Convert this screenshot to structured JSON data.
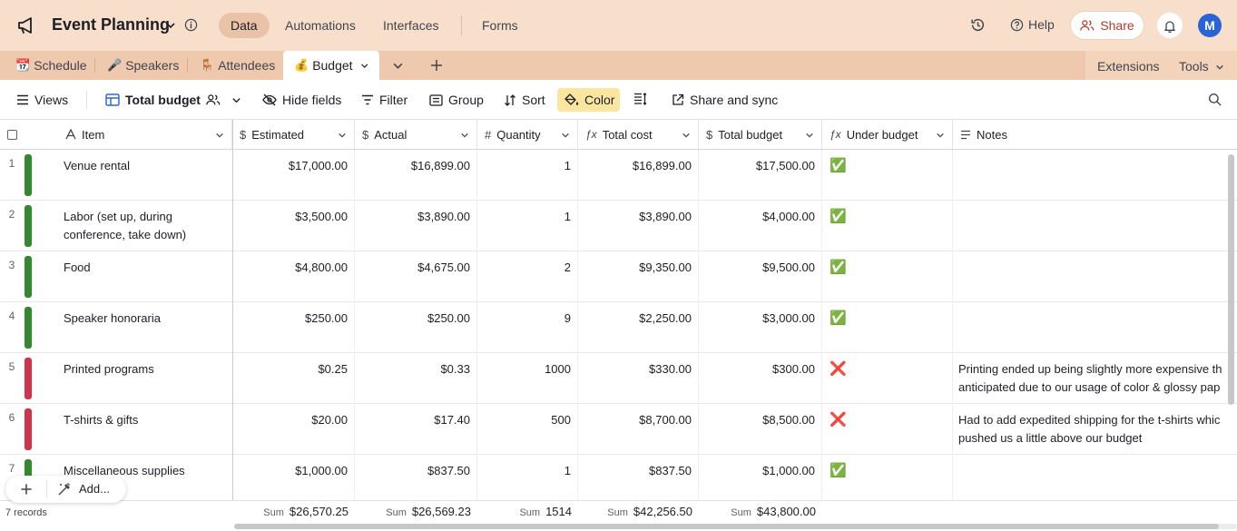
{
  "header": {
    "base_title": "Event Planning",
    "nav": [
      "Data",
      "Automations",
      "Interfaces",
      "Forms"
    ],
    "help_label": "Help",
    "share_label": "Share",
    "avatar_initial": "M"
  },
  "tables": [
    {
      "emoji": "📆",
      "label": "Schedule"
    },
    {
      "emoji": "🎤",
      "label": "Speakers"
    },
    {
      "emoji": "🪑",
      "label": "Attendees"
    },
    {
      "emoji": "💰",
      "label": "Budget"
    }
  ],
  "tabbar_right": {
    "extensions": "Extensions",
    "tools": "Tools"
  },
  "viewbar": {
    "views": "Views",
    "view_name": "Total budget",
    "hide_fields": "Hide fields",
    "filter": "Filter",
    "group": "Group",
    "sort": "Sort",
    "color": "Color",
    "share_sync": "Share and sync"
  },
  "columns": [
    "Item",
    "Estimated",
    "Actual",
    "Quantity",
    "Total cost",
    "Total budget",
    "Under budget",
    "Notes"
  ],
  "rows": [
    {
      "n": "1",
      "color": "#338a2e",
      "item": [
        "Venue rental"
      ],
      "estimated": "$17,000.00",
      "actual": "$16,899.00",
      "quantity": "1",
      "total_cost": "$16,899.00",
      "total_budget": "$17,500.00",
      "under": "✅",
      "notes": []
    },
    {
      "n": "2",
      "color": "#338a2e",
      "item": [
        "Labor (set up, during",
        "conference, take down)"
      ],
      "estimated": "$3,500.00",
      "actual": "$3,890.00",
      "quantity": "1",
      "total_cost": "$3,890.00",
      "total_budget": "$4,000.00",
      "under": "✅",
      "notes": []
    },
    {
      "n": "3",
      "color": "#338a2e",
      "item": [
        "Food"
      ],
      "estimated": "$4,800.00",
      "actual": "$4,675.00",
      "quantity": "2",
      "total_cost": "$9,350.00",
      "total_budget": "$9,500.00",
      "under": "✅",
      "notes": []
    },
    {
      "n": "4",
      "color": "#338a2e",
      "item": [
        "Speaker honoraria"
      ],
      "estimated": "$250.00",
      "actual": "$250.00",
      "quantity": "9",
      "total_cost": "$2,250.00",
      "total_budget": "$3,000.00",
      "under": "✅",
      "notes": []
    },
    {
      "n": "5",
      "color": "#d0344a",
      "item": [
        "Printed programs"
      ],
      "estimated": "$0.25",
      "actual": "$0.33",
      "quantity": "1000",
      "total_cost": "$330.00",
      "total_budget": "$300.00",
      "under": "❌",
      "notes": [
        "Printing ended up being slightly more expensive th",
        "anticipated due to our usage of color & glossy pap"
      ]
    },
    {
      "n": "6",
      "color": "#d0344a",
      "item": [
        "T-shirts & gifts"
      ],
      "estimated": "$20.00",
      "actual": "$17.40",
      "quantity": "500",
      "total_cost": "$8,700.00",
      "total_budget": "$8,500.00",
      "under": "❌",
      "notes": [
        "Had to add expedited shipping for the t-shirts whic",
        "pushed us a little above our budget"
      ]
    },
    {
      "n": "7",
      "color": "#338a2e",
      "item": [
        "Miscellaneous supplies"
      ],
      "estimated": "$1,000.00",
      "actual": "$837.50",
      "quantity": "1",
      "total_cost": "$837.50",
      "total_budget": "$1,000.00",
      "under": "✅",
      "notes": []
    }
  ],
  "footer": {
    "records": "7 records",
    "sum_label": "Sum",
    "sums": {
      "estimated": "$26,570.25",
      "actual": "$26,569.23",
      "quantity": "1514",
      "total_cost": "$42,256.50",
      "total_budget": "$43,800.00"
    }
  },
  "add_bar": {
    "add_label": "Add..."
  },
  "colors": {
    "topbar": "#f8dfcc",
    "tabbar": "#efc9ad",
    "under_budget_green": "#338a2e",
    "over_budget_red": "#d0344a",
    "color_button": "#fbe6a0"
  }
}
